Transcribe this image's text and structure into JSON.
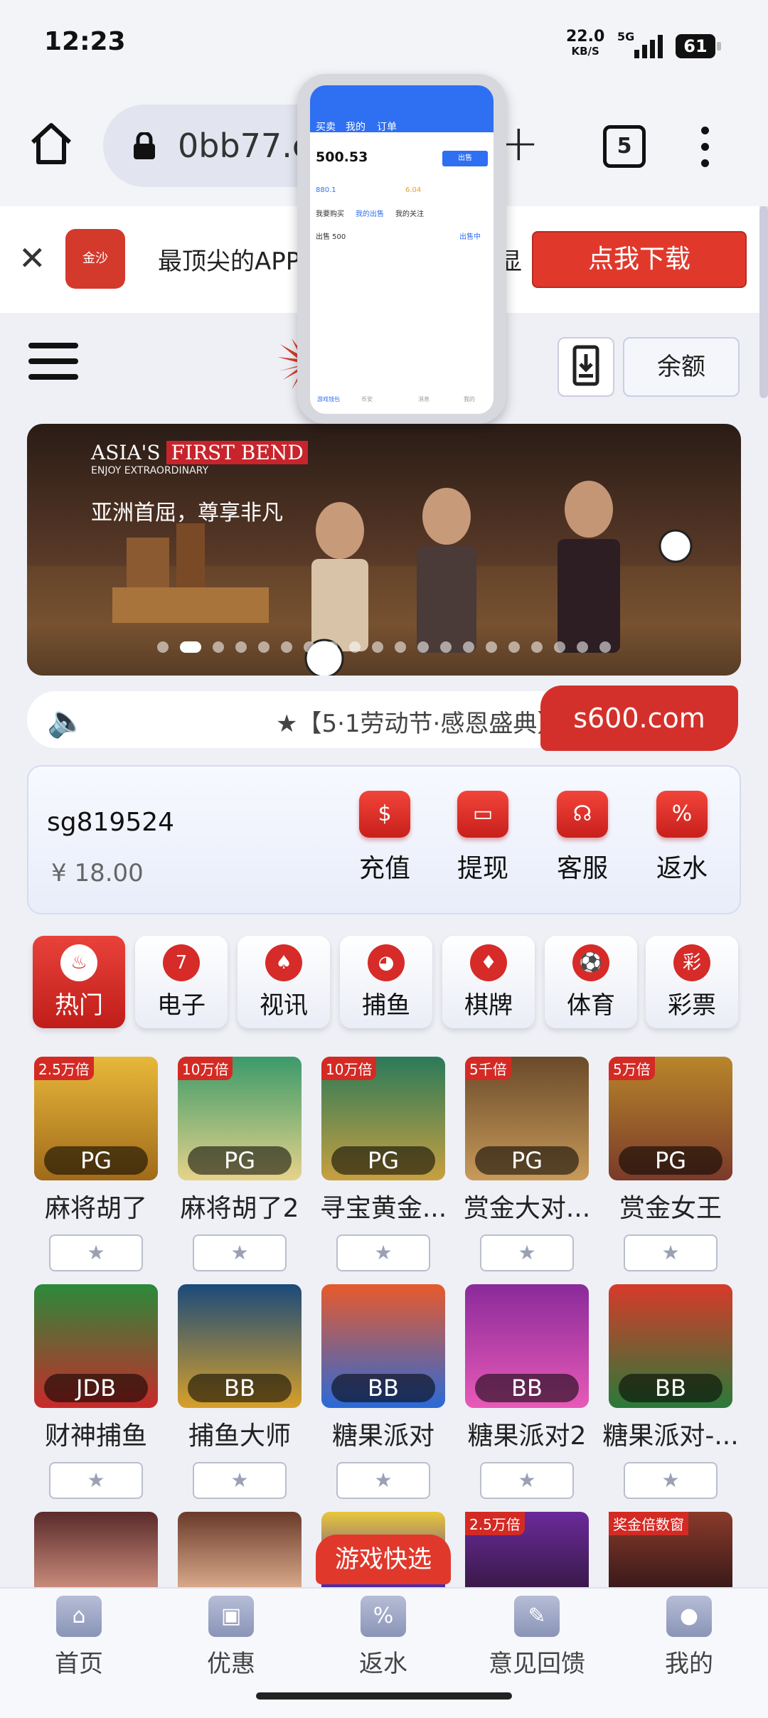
{
  "status": {
    "time": "12:23",
    "net_speed": "22.0",
    "net_unit": "KB/S",
    "network": "5G",
    "battery": "61"
  },
  "browser": {
    "url": "0bb77.co",
    "tab_count": "5",
    "new_tab": "+"
  },
  "app_banner": {
    "close": "✕",
    "logo_text": "金沙",
    "text": "最顶尖的APP",
    "text_tail": "显",
    "download_label": "点我下载"
  },
  "header": {
    "balance_label": "余额"
  },
  "hero": {
    "line1_a": "ASIA'S",
    "line1_b": "FIRST BEND",
    "line2": "ENJOY EXTRAORDINARY",
    "line3": "亚洲首屈，尊享非凡"
  },
  "marquee": {
    "text": "★【5·1劳动节·感恩盛典】",
    "link": "s600.com"
  },
  "account": {
    "username": "sg819524",
    "balance": "¥ 18.00"
  },
  "actions": [
    {
      "label": "充值",
      "icon": "money-bag-icon"
    },
    {
      "label": "提现",
      "icon": "card-icon"
    },
    {
      "label": "客服",
      "icon": "headset-icon"
    },
    {
      "label": "返水",
      "icon": "percent-icon"
    }
  ],
  "categories": [
    {
      "label": "热门",
      "icon": "fire-icon"
    },
    {
      "label": "电子",
      "icon": "seven-icon"
    },
    {
      "label": "视讯",
      "icon": "spade-icon"
    },
    {
      "label": "捕鱼",
      "icon": "fish-icon"
    },
    {
      "label": "棋牌",
      "icon": "cards-icon"
    },
    {
      "label": "体育",
      "icon": "ball-icon"
    },
    {
      "label": "彩票",
      "icon": "lottery-icon"
    }
  ],
  "games_row1": [
    {
      "name": "麻将胡了",
      "provider": "PG",
      "badge": "2.5万倍"
    },
    {
      "name": "麻将胡了2",
      "provider": "PG",
      "badge": "10万倍"
    },
    {
      "name": "寻宝黄金...",
      "provider": "PG",
      "badge": "10万倍"
    },
    {
      "name": "赏金大对...",
      "provider": "PG",
      "badge": "5千倍"
    },
    {
      "name": "赏金女王",
      "provider": "PG",
      "badge": "5万倍"
    }
  ],
  "games_row2": [
    {
      "name": "财神捕鱼",
      "provider": "JDB"
    },
    {
      "name": "捕鱼大师",
      "provider": "BB"
    },
    {
      "name": "糖果派对",
      "provider": "BB"
    },
    {
      "name": "糖果派对2",
      "provider": "BB"
    },
    {
      "name": "糖果派对-...",
      "provider": "BB"
    }
  ],
  "games_row3_badges": {
    "b4": "2.5万倍",
    "b5": "奖金倍数窗"
  },
  "quick_game": "游戏快选",
  "bottom_nav": [
    {
      "label": "首页",
      "icon": "home-icon"
    },
    {
      "label": "优惠",
      "icon": "gift-icon"
    },
    {
      "label": "返水",
      "icon": "percent-icon"
    },
    {
      "label": "意见回馈",
      "icon": "edit-icon"
    },
    {
      "label": "我的",
      "icon": "user-icon"
    }
  ],
  "preview": {
    "tabs": [
      "买卖",
      "我的",
      "订单"
    ],
    "value": "500.53",
    "sell_btn": "出售",
    "row1": "880.1",
    "row1b": "6.04",
    "subtabs": [
      "我要购买",
      "我的出售",
      "我的关注"
    ],
    "order": "出售 500",
    "status": "出售中",
    "nav": [
      "游戏钱包",
      "币安",
      "消息",
      "我的"
    ]
  },
  "colors": {
    "accent": "#d4302b",
    "bg": "#eef0f6",
    "preview_blue": "#2f6ff2"
  }
}
